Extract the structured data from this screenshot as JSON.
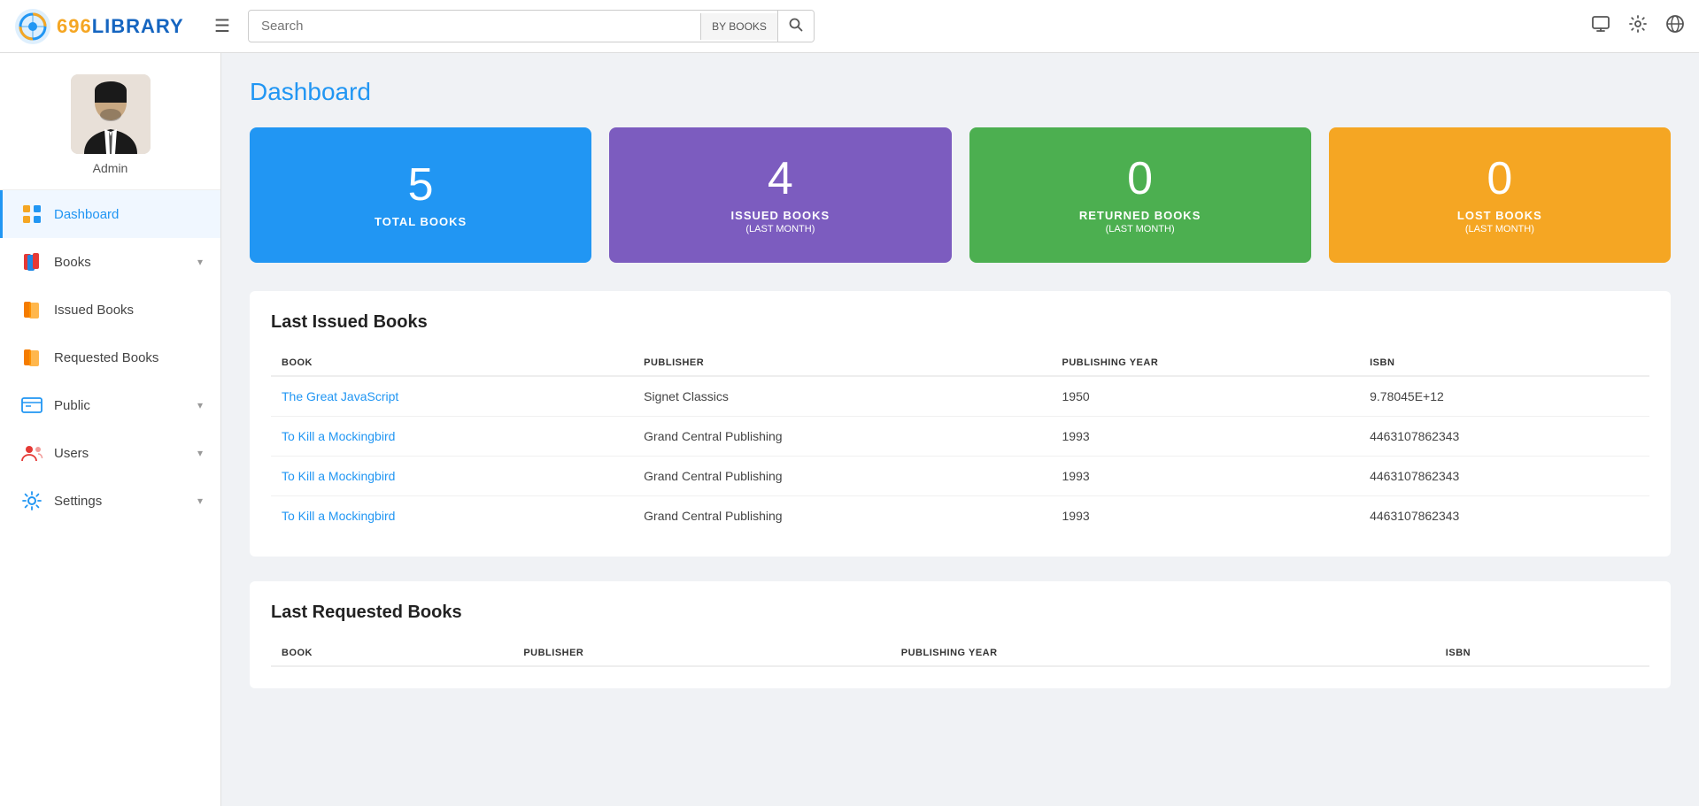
{
  "app": {
    "name": "696LIBRARY",
    "name_colored": "696",
    "name_rest": "LIBRARY"
  },
  "header": {
    "search_placeholder": "Search",
    "search_by_label": "BY BOOKS",
    "hamburger_label": "☰"
  },
  "user": {
    "role": "Admin"
  },
  "nav": {
    "items": [
      {
        "id": "dashboard",
        "label": "Dashboard",
        "active": true,
        "has_chevron": false
      },
      {
        "id": "books",
        "label": "Books",
        "active": false,
        "has_chevron": true
      },
      {
        "id": "issued-books",
        "label": "Issued Books",
        "active": false,
        "has_chevron": false
      },
      {
        "id": "requested-books",
        "label": "Requested Books",
        "active": false,
        "has_chevron": false
      },
      {
        "id": "public",
        "label": "Public",
        "active": false,
        "has_chevron": true
      },
      {
        "id": "users",
        "label": "Users",
        "active": false,
        "has_chevron": true
      },
      {
        "id": "settings",
        "label": "Settings",
        "active": false,
        "has_chevron": true
      }
    ]
  },
  "dashboard": {
    "title": "Dashboard",
    "stat_cards": [
      {
        "id": "total-books",
        "number": "5",
        "label": "TOTAL BOOKS",
        "sublabel": "",
        "color": "blue"
      },
      {
        "id": "issued-books",
        "number": "4",
        "label": "ISSUED BOOKS",
        "sublabel": "(LAST MONTH)",
        "color": "purple"
      },
      {
        "id": "returned-books",
        "number": "0",
        "label": "RETURNED BOOKS",
        "sublabel": "(LAST MONTH)",
        "color": "green"
      },
      {
        "id": "lost-books",
        "number": "0",
        "label": "LOST BOOKS",
        "sublabel": "(LAST MONTH)",
        "color": "orange"
      }
    ],
    "issued_section": {
      "title": "Last Issued Books",
      "columns": [
        "BOOK",
        "PUBLISHER",
        "PUBLISHING YEAR",
        "ISBN"
      ],
      "rows": [
        {
          "book": "The Great JavaScript",
          "publisher": "Signet Classics",
          "year": "1950",
          "isbn": "9.78045E+12"
        },
        {
          "book": "To Kill a Mockingbird",
          "publisher": "Grand Central Publishing",
          "year": "1993",
          "isbn": "4463107862343"
        },
        {
          "book": "To Kill a Mockingbird",
          "publisher": "Grand Central Publishing",
          "year": "1993",
          "isbn": "4463107862343"
        },
        {
          "book": "To Kill a Mockingbird",
          "publisher": "Grand Central Publishing",
          "year": "1993",
          "isbn": "4463107862343"
        }
      ]
    },
    "requested_section": {
      "title": "Last Requested Books",
      "columns": [
        "BOOK",
        "PUBLISHER",
        "PUBLISHING YEAR",
        "ISBN"
      ],
      "rows": []
    }
  }
}
